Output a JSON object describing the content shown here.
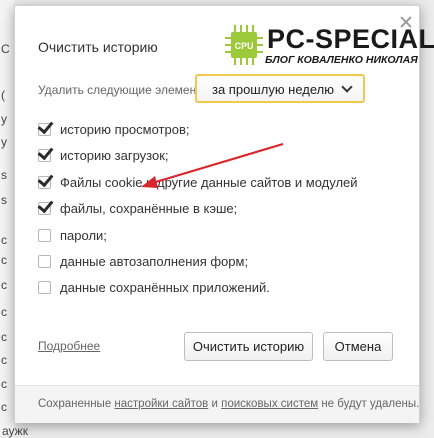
{
  "background": {
    "fragments": [
      "С",
      "(",
      "у",
      "у",
      "s",
      "s",
      "с",
      "с",
      "с",
      "с",
      "с",
      "с",
      "с",
      "с"
    ],
    "bottom_text": "аужк"
  },
  "dialog": {
    "title": "Очистить историю",
    "remove_label": "Удалить следующие элементы:",
    "period_select": {
      "value": "за прошлую неделю"
    },
    "options": [
      {
        "label": "историю просмотров;",
        "checked": true
      },
      {
        "label": "историю загрузок;",
        "checked": true
      },
      {
        "label": "Файлы cookie и другие данные сайтов и модулей",
        "checked": true
      },
      {
        "label": "файлы, сохранённые в кэше;",
        "checked": true
      },
      {
        "label": "пароли;",
        "checked": false
      },
      {
        "label": "данные автозаполнения форм;",
        "checked": false
      },
      {
        "label": "данные сохранённых приложений.",
        "checked": false
      }
    ],
    "more_link": "Подробнее",
    "clear_button": "Очистить историю",
    "cancel_button": "Отмена",
    "footer": {
      "text_1": "Сохраненные ",
      "link_1": "настройки сайтов",
      "text_2": " и ",
      "link_2": "поисковых систем",
      "text_3": " не будут удалены."
    }
  },
  "watermark": {
    "chip_label": "CPU",
    "title": "PC-SPECIAL",
    "subtitle": "БЛОГ КОВАЛЕНКО НИКОЛАЯ"
  },
  "colors": {
    "select_border": "#f2c94c",
    "arrow": "#d9262b",
    "chip_green": "#9bc93a"
  }
}
